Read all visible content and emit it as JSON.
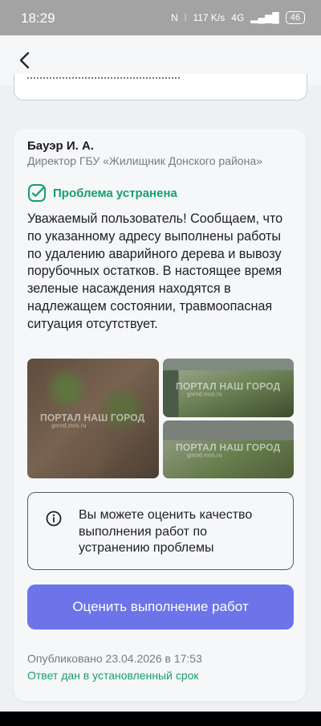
{
  "status_bar": {
    "time": "18:29",
    "network_speed": "117 K/s",
    "network_type": "4G",
    "battery": "46"
  },
  "author": {
    "name": "Бауэр И. А.",
    "position": "Директор ГБУ «Жилищник Донского района»"
  },
  "status": {
    "label": "Проблема устранена",
    "color": "#16a06d"
  },
  "message": "Уважаемый пользователь! Сообщаем, что по указанному адресу выполнены работы по удалению аварийного дерева и вывозу порубочных остатков. В настоящее время зеленые насаждения находятся в надлежащем состоянии, травмоопасная ситуация отсутствует.",
  "photos": [
    {
      "watermark": "ПОРТАЛ НАШ ГОРОД",
      "source": "gorod.mos.ru"
    },
    {
      "watermark": "ПОРТАЛ НАШ ГОРОД",
      "source": "gorod.mos.ru"
    },
    {
      "watermark": "ПОРТАЛ НАШ ГОРОД",
      "source": "gorod.mos.ru"
    }
  ],
  "rating_info": {
    "text": "Вы можете оценить качество выполнения работ по устранению проблемы",
    "icon": "info-icon"
  },
  "rate_button_label": "Оценить выполнение работ",
  "published": "Опубликовано 23.04.2026 в 17:53",
  "answer_status": "Ответ дан в установленный срок",
  "colors": {
    "accent": "#6d74ea",
    "success": "#16a06d"
  }
}
